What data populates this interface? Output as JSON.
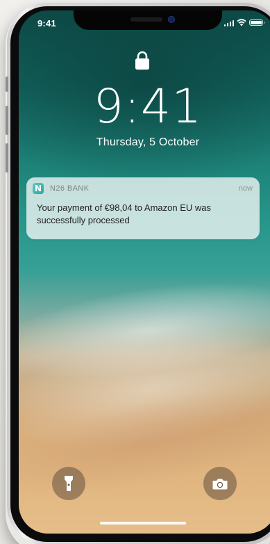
{
  "status_bar": {
    "time": "9:41",
    "icons": [
      "cellular-signal-icon",
      "wifi-icon",
      "battery-icon"
    ]
  },
  "lock_screen": {
    "lock_icon": "lock-icon",
    "time": "9:41",
    "date": "Thursday, 5 October"
  },
  "notification": {
    "app_icon_letter": "N",
    "app_name": "N26 BANK",
    "time": "now",
    "message": "Your payment of €98,04 to Amazon EU was successfully processed"
  },
  "quick_actions": {
    "flashlight_icon": "flashlight-icon",
    "camera_icon": "camera-icon"
  },
  "colors": {
    "notification_bg": "#ebf3f1",
    "app_icon": "#2da59f",
    "button_bg": "#64503e"
  }
}
